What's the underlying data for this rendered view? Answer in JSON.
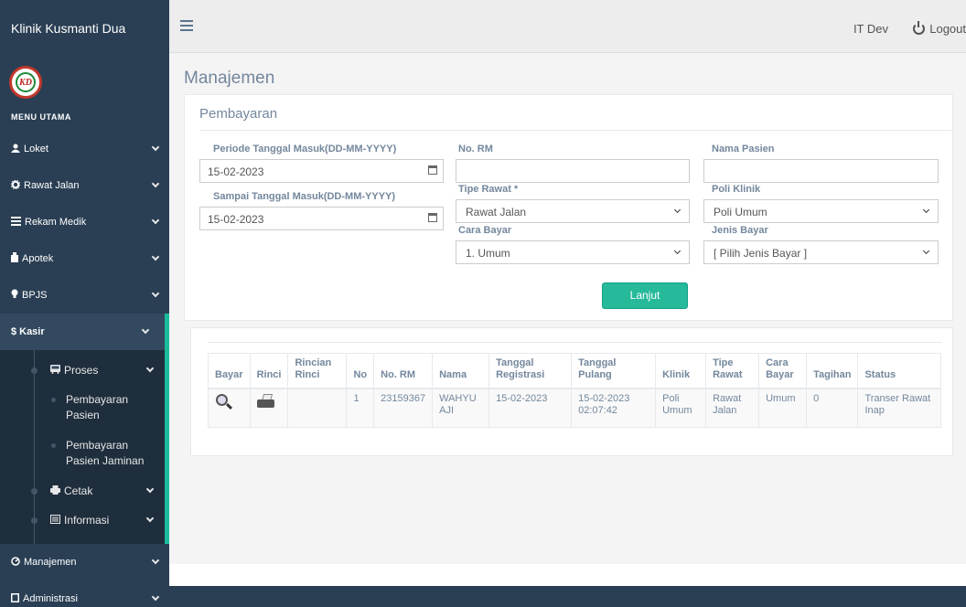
{
  "app": {
    "name": "Klinik Kusmanti Dua",
    "logo_text": "KD"
  },
  "sidebar": {
    "menu_title": "MENU UTAMA",
    "items": [
      {
        "label": "Loket",
        "icon": "user-icon"
      },
      {
        "label": "Rawat Jalan",
        "icon": "gear-icon"
      },
      {
        "label": "Rekam Medik",
        "icon": "list-icon"
      },
      {
        "label": "Apotek",
        "icon": "medkit-icon"
      },
      {
        "label": "BPJS",
        "icon": "lightbulb-icon"
      }
    ],
    "active": {
      "label": "Kasir",
      "icon_char": "$",
      "sub": {
        "proses": "Proses",
        "pembayaran_pasien_1": "Pembayaran",
        "pembayaran_pasien_2": "Pasien",
        "pembayaran_jaminan_1": "Pembayaran",
        "pembayaran_jaminan_2": "Pasien Jaminan",
        "cetak": "Cetak",
        "informasi": "Informasi"
      }
    },
    "bottom_items": [
      {
        "label": "Manajemen",
        "icon": "dashboard-icon"
      },
      {
        "label": "Administrasi",
        "icon": "square-icon"
      }
    ]
  },
  "topbar": {
    "user": "IT Dev",
    "logout": "Logout"
  },
  "page": {
    "title": "Manajemen",
    "panel_title": "Pembayaran"
  },
  "form": {
    "periode_label": "Periode Tanggal Masuk(DD-MM-YYYY)",
    "periode_value": "15-02-2023",
    "sampai_label": "Sampai Tanggal Masuk(DD-MM-YYYY)",
    "sampai_value": "15-02-2023",
    "no_rm_label": "No. RM",
    "no_rm_value": "",
    "nama_label": "Nama Pasien",
    "nama_value": "",
    "tipe_label": "Tipe Rawat *",
    "tipe_value": "Rawat Jalan",
    "poli_label": "Poli Klinik",
    "poli_value": "Poli Umum",
    "cara_label": "Cara Bayar",
    "cara_value": "1. Umum",
    "jenis_label": "Jenis Bayar",
    "jenis_value": "[ Pilih Jenis Bayar ]",
    "submit": "Lanjut"
  },
  "table": {
    "headers": {
      "bayar": "Bayar",
      "rinci": "Rinci",
      "rincian_1": "Rincian",
      "rincian_2": "Rinci",
      "no": "No",
      "no_rm": "No. RM",
      "nama": "Nama",
      "tgl_reg_1": "Tanggal",
      "tgl_reg_2": "Registrasi",
      "tgl_pulang": "Tanggal Pulang",
      "klinik": "Klinik",
      "tipe_1": "Tipe",
      "tipe_2": "Rawat",
      "cara_1": "Cara",
      "cara_2": "Bayar",
      "tagihan": "Tagihan",
      "status": "Status"
    },
    "rows": [
      {
        "rincian": "",
        "no": "1",
        "no_rm": "23159367",
        "nama_1": "WAHYU",
        "nama_2": "AJI",
        "tgl_reg": "15-02-2023",
        "tgl_pulang_1": "15-02-2023",
        "tgl_pulang_2": "02:07:42",
        "klinik_1": "Poli",
        "klinik_2": "Umum",
        "tipe_1": "Rawat",
        "tipe_2": "Jalan",
        "cara": "Umum",
        "tagihan": "0",
        "status_1": "Transer Rawat",
        "status_2": "Inap"
      }
    ]
  }
}
